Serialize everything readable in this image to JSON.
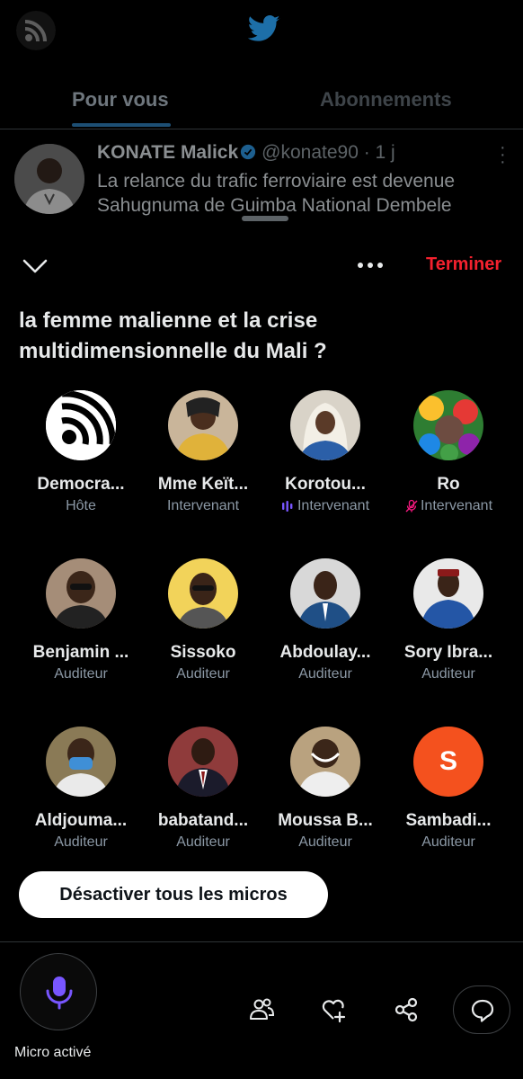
{
  "timeline": {
    "tabs": [
      {
        "label": "Pour vous",
        "active": true
      },
      {
        "label": "Abonnements",
        "active": false
      }
    ],
    "tweet": {
      "author": "KONATE Malick",
      "handle": "@konate90 · 1 j",
      "text_line1": "La relance du trafic ferroviaire est devenue",
      "text_line2": "Sahugnuma de Guimba National Dembele"
    }
  },
  "space": {
    "end_label": "Terminer",
    "title": "la femme malienne et la crise multidimensionnelle du Mali ?",
    "participants": [
      {
        "name": "Democra...",
        "role": "Hôte"
      },
      {
        "name": "Mme Keït...",
        "role": "Intervenant"
      },
      {
        "name": "Korotou...",
        "role": "Intervenant",
        "role_icon": "speaking-icon"
      },
      {
        "name": "Ro",
        "role": "Intervenant",
        "role_icon": "mic-muted-icon"
      },
      {
        "name": "Benjamin ...",
        "role": "Auditeur"
      },
      {
        "name": "Sissoko",
        "role": "Auditeur"
      },
      {
        "name": "Abdoulay...",
        "role": "Auditeur"
      },
      {
        "name": "Sory Ibra...",
        "role": "Auditeur"
      },
      {
        "name": "Aldjouma...",
        "role": "Auditeur"
      },
      {
        "name": "babatand...",
        "role": "Auditeur"
      },
      {
        "name": "Moussa B...",
        "role": "Auditeur"
      },
      {
        "name": "Sambadi...",
        "role": "Auditeur",
        "avatar_letter": "S"
      }
    ],
    "mute_all_label": "Désactiver tous les micros",
    "mic_label": "Micro activé"
  },
  "colors": {
    "accent_red": "#f4212e",
    "twitter_blue": "#1d9bf0",
    "mic_purple": "#7856ff",
    "letter_avatar": "#f4511e"
  }
}
